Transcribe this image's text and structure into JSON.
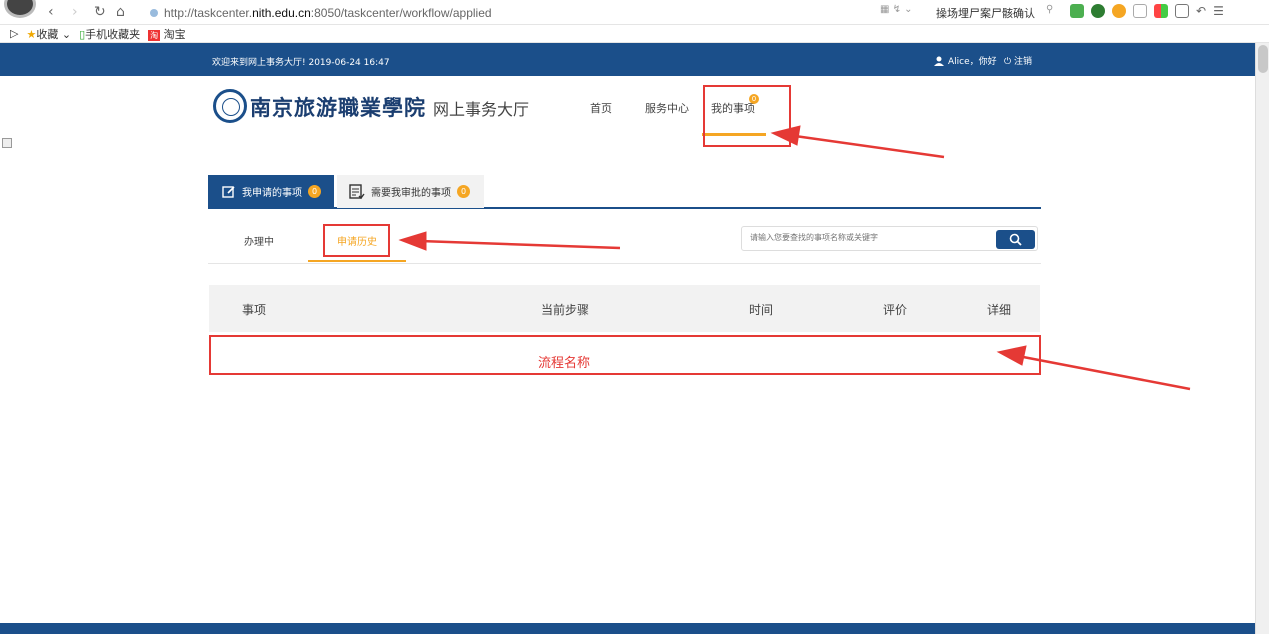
{
  "browser": {
    "url_prefix": "http://taskcenter.",
    "url_host": "nith.edu.cn",
    "url_rest": ":8050/taskcenter/workflow/applied",
    "search_text": "操场埋尸案尸骸确认",
    "bookmarks": [
      "收藏",
      "手机收藏夹",
      "淘宝"
    ]
  },
  "header": {
    "welcome": "欢迎来到网上事务大厅! 2019-06-24 16:47",
    "user": "Alice，你好",
    "logout": "注销"
  },
  "logo": {
    "name": "南京旅游職業學院",
    "sub": "网上事务大厅"
  },
  "nav": {
    "home": "首页",
    "service": "服务中心",
    "mine": "我的事项",
    "mine_badge": "0"
  },
  "tabs": {
    "applied": "我申请的事项",
    "applied_badge": "0",
    "approve": "需要我审批的事项",
    "approve_badge": "0"
  },
  "subtabs": {
    "in_progress": "办理中",
    "history": "申请历史"
  },
  "search": {
    "placeholder": "请输入您要查找的事项名称或关键字"
  },
  "table": {
    "headers": [
      "事项",
      "当前步骤",
      "时间",
      "评价",
      "详细"
    ],
    "rows": [
      {
        "name": "流程名称"
      }
    ]
  },
  "colors": {
    "primary": "#1b4f8a",
    "accent": "#f5a623",
    "annotation": "#e53935"
  }
}
